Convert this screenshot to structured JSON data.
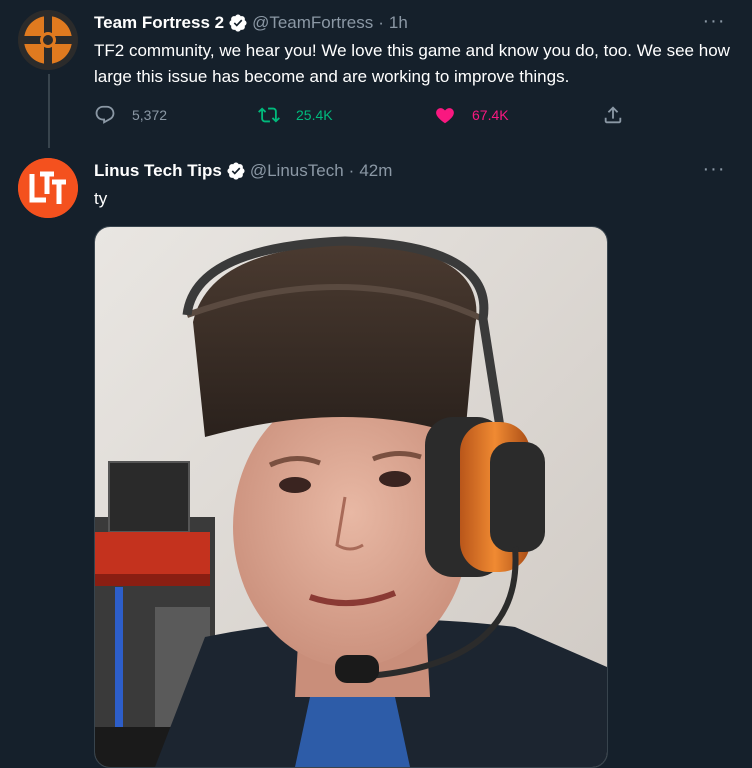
{
  "tweets": [
    {
      "display_name": "Team Fortress 2",
      "handle": "@TeamFortress",
      "separator": "·",
      "time": "1h",
      "text": "TF2 community, we hear you! We love this game and know you do, too. We see how large this issue has become and are working to improve things.",
      "replies": "5,372",
      "retweets": "25.4K",
      "likes": "67.4K",
      "more": "···"
    },
    {
      "display_name": "Linus Tech Tips",
      "handle": "@LinusTech",
      "separator": "·",
      "time": "42m",
      "text": "ty",
      "more": "···"
    }
  ],
  "colors": {
    "background": "#15202b",
    "secondary_text": "#8b98a5",
    "verified": "#ffffff",
    "retweet_green": "#00ba7c",
    "like_pink": "#f91880",
    "tf2_orange": "#e07a1f",
    "ltt_orange": "#f4511e"
  },
  "icons": {
    "reply": "reply-icon",
    "retweet": "retweet-icon",
    "like": "heart-icon",
    "share": "share-icon",
    "verified": "verified-badge-icon",
    "more": "more-icon"
  }
}
